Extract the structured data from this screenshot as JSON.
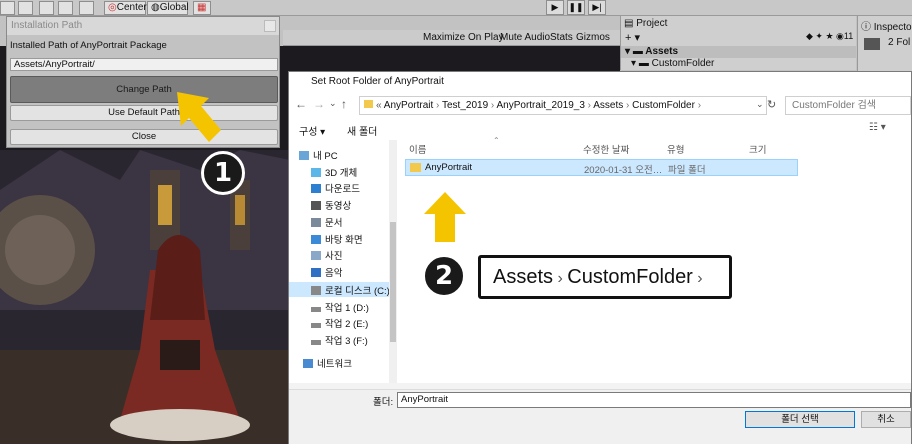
{
  "unity": {
    "toolbar": {
      "center_label": "Center",
      "global_label": "Global"
    },
    "game_header": {
      "maximize": "Maximize On Play",
      "mute": "Mute Audio",
      "stats": "Stats",
      "gizmos": "Gizmos"
    },
    "project": {
      "tab": "Project",
      "root": "Assets",
      "child": "CustomFolder",
      "count": "11"
    },
    "inspector": {
      "tab": "Inspector",
      "summary": "2 Fol"
    }
  },
  "install_window": {
    "title": "Installation Path",
    "label": "Installed Path of AnyPortrait Package",
    "path_value": "Assets/AnyPortrait/",
    "change_button": "Change Path",
    "default_button": "Use Default Path",
    "close_button": "Close"
  },
  "dialog": {
    "title": "Set Root Folder of AnyPortrait",
    "breadcrumb": [
      "AnyPortrait",
      "Test_2019",
      "AnyPortrait_2019_3",
      "Assets",
      "CustomFolder"
    ],
    "search_placeholder": "CustomFolder 검색",
    "organize": "구성 ▾",
    "new_folder": "새 폴더",
    "nav_items": [
      {
        "label": "내 PC",
        "icon": "pc-icon"
      },
      {
        "label": "3D 개체",
        "icon": "3d-objects-icon"
      },
      {
        "label": "다운로드",
        "icon": "download-icon"
      },
      {
        "label": "동영상",
        "icon": "video-icon"
      },
      {
        "label": "문서",
        "icon": "document-icon"
      },
      {
        "label": "바탕 화면",
        "icon": "desktop-icon"
      },
      {
        "label": "사진",
        "icon": "picture-icon"
      },
      {
        "label": "음악",
        "icon": "music-icon"
      },
      {
        "label": "로컬 디스크 (C:)",
        "icon": "drive-icon"
      },
      {
        "label": "작업 1 (D:)",
        "icon": "drive-icon"
      },
      {
        "label": "작업 2 (E:)",
        "icon": "drive-icon"
      },
      {
        "label": "작업 3 (F:)",
        "icon": "drive-icon"
      },
      {
        "label": "네트워크",
        "icon": "network-icon"
      }
    ],
    "columns": {
      "name": "이름",
      "modified": "수정한 날짜",
      "type": "유형",
      "size": "크기"
    },
    "files": [
      {
        "name": "AnyPortrait",
        "modified": "2020-01-31 오전…",
        "type": "파일 폴더",
        "size": ""
      }
    ],
    "folder_label": "폴더:",
    "folder_value": "AnyPortrait",
    "select_button": "폴더 선택",
    "cancel_button": "취소"
  },
  "annotations": {
    "step1": "1",
    "step2": "2",
    "callout_path": [
      "Assets",
      "CustomFolder"
    ],
    "arrow_color": "#f5c400"
  }
}
